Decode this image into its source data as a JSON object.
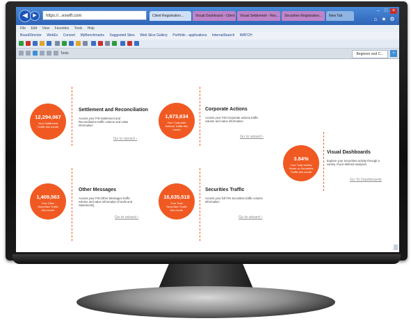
{
  "browser": {
    "url": "https://...eswift.com",
    "tabs": [
      {
        "label": "Client Registration..."
      },
      {
        "label": "Visual Dashboard - Client"
      },
      {
        "label": "Visual Settlement - Rec..."
      },
      {
        "label": "Securities Registration..."
      },
      {
        "label": "New Tab"
      }
    ],
    "menu": [
      "File",
      "Edit",
      "View",
      "Favorites",
      "Tools",
      "Help"
    ],
    "favorites": [
      "BoardDirector",
      "WebEx",
      "Convert",
      "MyBenchmarks",
      "Suggested Sites",
      "Web Slice Gallery",
      "Portfolio - applications",
      "InternalSearch",
      "WATCH"
    ],
    "tools_label": "Tools",
    "right_tab": "Beginner and C..."
  },
  "colors": {
    "accent": "#f05a22"
  },
  "cards": [
    {
      "number": "12,294,067",
      "caption": "Your Settlement Traffic this month",
      "title": "Settlement and Reconciliation",
      "desc": "Access your FIN Settlement and Reconciliation traffic volume and value information",
      "link": "Go to wizard ›"
    },
    {
      "number": "1,673,634",
      "caption": "Your Corporate Actions Traffic this month",
      "title": "Corporate Actions",
      "desc": "Access your FIN Corporate actions traffic volume and value information",
      "link": "Go to wizard ›"
    },
    {
      "number": "3.84%",
      "caption": "Your Total activity Share on Securities Traffic this month",
      "title": "Visual Dashboards",
      "desc": "Explore your Securities activity through a variety of pre-defined analyses",
      "link": "Go To Dashboards"
    },
    {
      "number": "1,409,563",
      "caption": "Your Other Securities Traffic this month",
      "title": "Other Messages",
      "desc": "Access your FIN Other Messages traffic volume and value information (Funds and Statements)",
      "link": "Go to wizard ›"
    },
    {
      "number": "16,635,518",
      "caption": "Your Total Securities Traffic this month",
      "title": "Securities Traffic",
      "desc": "Access your full FIN Securities traffic volume information",
      "link": "Go to wizard ›"
    }
  ]
}
